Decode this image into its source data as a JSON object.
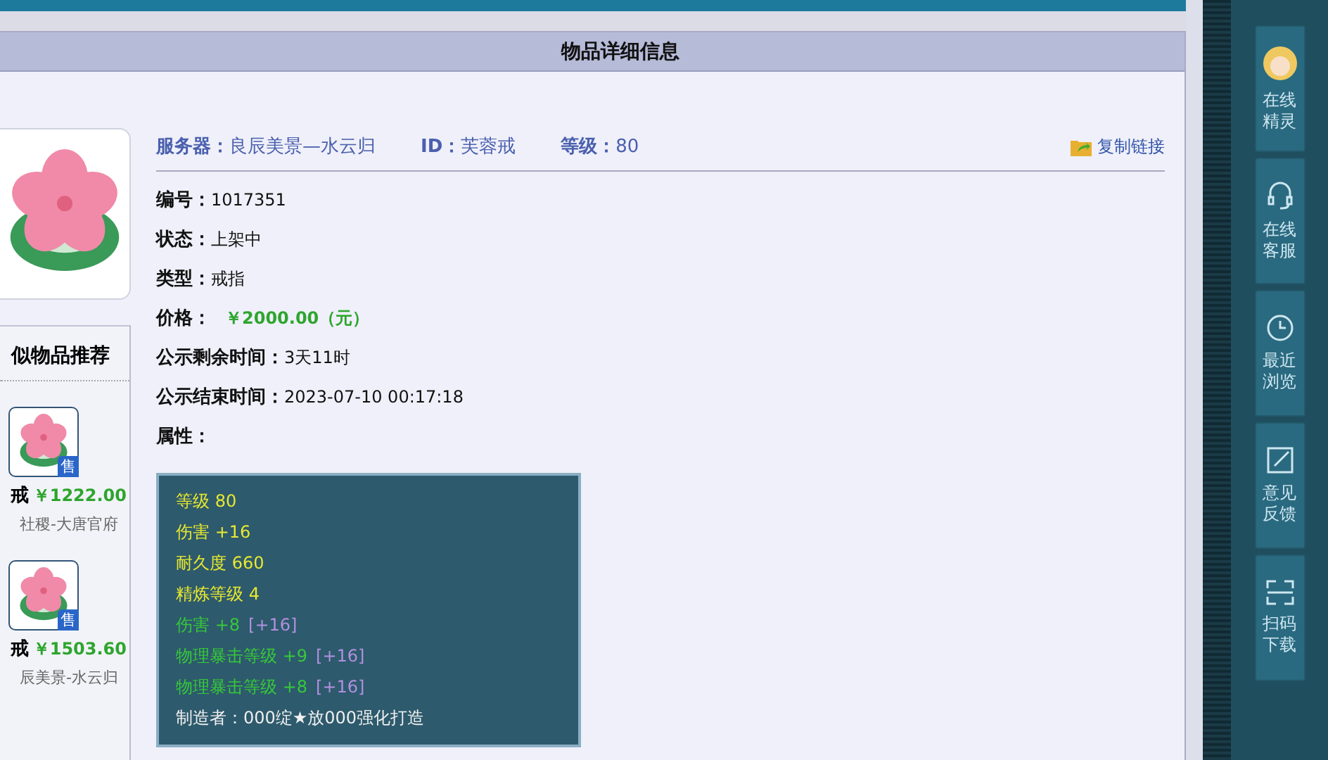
{
  "panel": {
    "title": "物品详细信息"
  },
  "summary": [
    {
      "label": "服务器：",
      "value": "良辰美景—水云归"
    },
    {
      "label": "ID：",
      "value": "芙蓉戒"
    },
    {
      "label": "等级：",
      "value": "80"
    }
  ],
  "copy_link": "复制链接",
  "fields": [
    {
      "label": "编号：",
      "value": "1017351",
      "kind": "plain"
    },
    {
      "label": "状态：",
      "value": "上架中",
      "kind": "plain"
    },
    {
      "label": "类型：",
      "value": "戒指",
      "kind": "plain"
    },
    {
      "label": "价格：",
      "value": "￥2000.00（元）",
      "kind": "price"
    },
    {
      "label": "公示剩余时间：",
      "value": "3天11时",
      "kind": "plain"
    },
    {
      "label": "公示结束时间：",
      "value": "2023-07-10 00:17:18",
      "kind": "plain"
    },
    {
      "label": "属性："
    }
  ],
  "attributes": [
    {
      "kind": "base",
      "text": "等级 80"
    },
    {
      "kind": "base",
      "text": "伤害 +16"
    },
    {
      "kind": "base",
      "text": "耐久度 660"
    },
    {
      "kind": "base",
      "text": "精炼等级 4"
    },
    {
      "kind": "bonus",
      "text": "伤害 +8",
      "extra": "[+16]"
    },
    {
      "kind": "bonus",
      "text": "物理暴击等级 +9",
      "extra": "[+16]"
    },
    {
      "kind": "bonus",
      "text": "物理暴击等级 +8",
      "extra": "[+16]"
    },
    {
      "kind": "maker",
      "text": "制造者：000绽★放000强化打造"
    }
  ],
  "similar": {
    "title": "似物品推荐",
    "items": [
      {
        "name": "戒",
        "price": "￥1222.00",
        "server": "社稷-大唐官府",
        "badge": "售"
      },
      {
        "name": "戒",
        "price": "￥1503.60",
        "server": "辰美景-水云归",
        "badge": "售"
      }
    ]
  },
  "sidebar": [
    {
      "kind": "avatar",
      "label": "在线精灵"
    },
    {
      "kind": "headset",
      "label": "在线客服"
    },
    {
      "kind": "clock",
      "label": "最近浏览"
    },
    {
      "kind": "edit",
      "label": "意见反馈"
    },
    {
      "kind": "scan",
      "label": "扫码下载"
    }
  ]
}
